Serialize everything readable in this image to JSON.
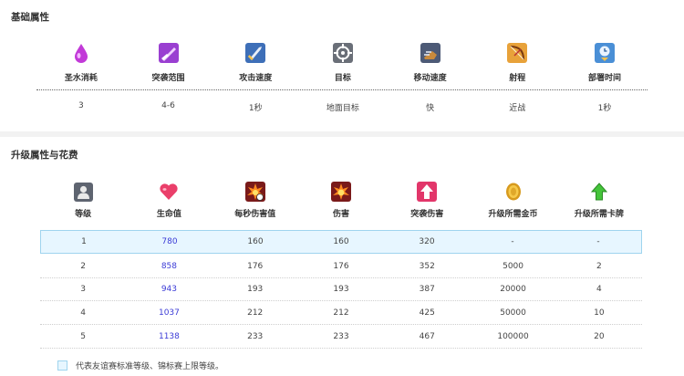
{
  "basic": {
    "title": "基础属性",
    "attrs": [
      {
        "label": "圣水消耗",
        "value": "3",
        "icon": "elixir-drop-icon"
      },
      {
        "label": "突袭范围",
        "value": "4-6",
        "icon": "charge-range-icon"
      },
      {
        "label": "攻击速度",
        "value": "1秒",
        "icon": "attack-speed-icon"
      },
      {
        "label": "目标",
        "value": "地面目标",
        "icon": "target-icon"
      },
      {
        "label": "移动速度",
        "value": "快",
        "icon": "movement-speed-icon"
      },
      {
        "label": "射程",
        "value": "近战",
        "icon": "range-bow-icon"
      },
      {
        "label": "部署时间",
        "value": "1秒",
        "icon": "deploy-time-icon"
      }
    ]
  },
  "upgrade": {
    "title": "升级属性与花费",
    "columns": [
      {
        "label": "等级",
        "icon": "level-avatar-icon"
      },
      {
        "label": "生命值",
        "icon": "heart-icon"
      },
      {
        "label": "每秒伤害值",
        "icon": "dps-explosion-icon"
      },
      {
        "label": "伤害",
        "icon": "damage-explosion-icon"
      },
      {
        "label": "突袭伤害",
        "icon": "charge-damage-arrow-icon"
      },
      {
        "label": "升级所需金币",
        "icon": "gold-coin-icon"
      },
      {
        "label": "升级所需卡牌",
        "icon": "card-upgrade-arrow-icon"
      }
    ],
    "rows": [
      [
        "1",
        "780",
        "160",
        "160",
        "320",
        "-",
        "-"
      ],
      [
        "2",
        "858",
        "176",
        "176",
        "352",
        "5000",
        "2"
      ],
      [
        "3",
        "943",
        "193",
        "193",
        "387",
        "20000",
        "4"
      ],
      [
        "4",
        "1037",
        "212",
        "212",
        "425",
        "50000",
        "10"
      ],
      [
        "5",
        "1138",
        "233",
        "233",
        "467",
        "100000",
        "20"
      ]
    ],
    "highlight_row": 0,
    "legend": "代表友谊赛标准等级、锦标赛上限等级。"
  },
  "colors": {
    "hp_text": "#3b3bd6",
    "highlight_bg": "#e7f6ff",
    "highlight_border": "#9fd4ee"
  }
}
